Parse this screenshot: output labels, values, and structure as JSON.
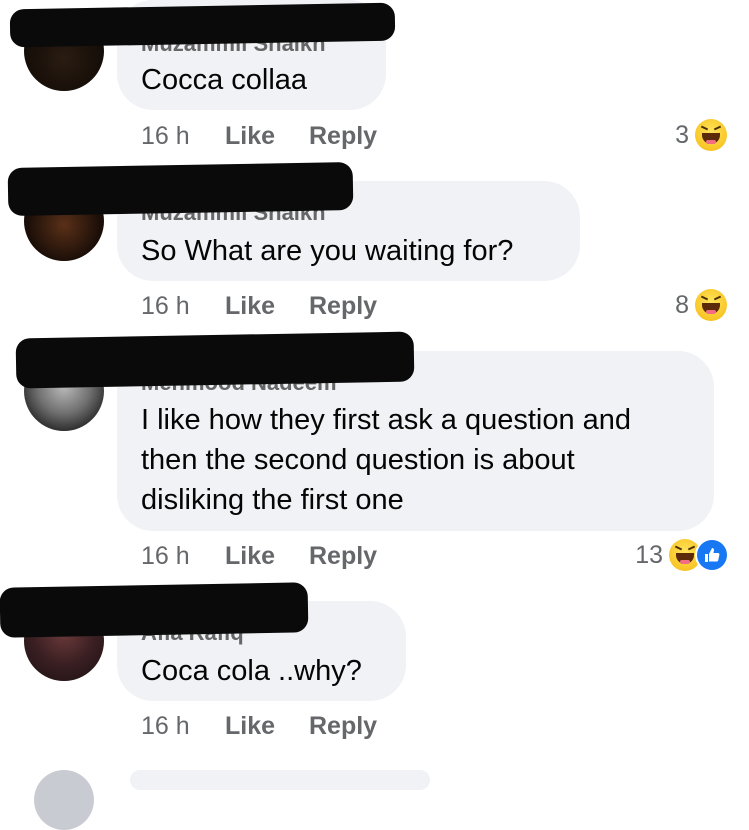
{
  "comments": [
    {
      "author": "Muzammil Shaikh",
      "text": "Cocca collaa",
      "time": "16 h",
      "like_label": "Like",
      "reply_label": "Reply",
      "reaction_count": "3",
      "reactions": [
        "haha-icon"
      ]
    },
    {
      "author": "Muzammil Shaikh",
      "text": "So What are you waiting for?",
      "time": "16 h",
      "like_label": "Like",
      "reply_label": "Reply",
      "reaction_count": "8",
      "reactions": [
        "haha-icon"
      ]
    },
    {
      "author": "Mehmood Nadeem",
      "text": "I like how they first ask a question and\nthen the second question is about\ndisliking the first one",
      "time": "16 h",
      "like_label": "Like",
      "reply_label": "Reply",
      "reaction_count": "13",
      "reactions": [
        "haha-icon",
        "like-icon"
      ]
    },
    {
      "author": "Afia Rafiq",
      "text": "Coca cola ..why?",
      "time": "16 h",
      "like_label": "Like",
      "reply_label": "Reply",
      "reaction_count": "",
      "reactions": []
    }
  ],
  "colors": {
    "bubble": "#f0f2f5",
    "meta_text": "#65676b",
    "like_blue": "#1877f2",
    "haha_yellow": "#f8c626"
  }
}
